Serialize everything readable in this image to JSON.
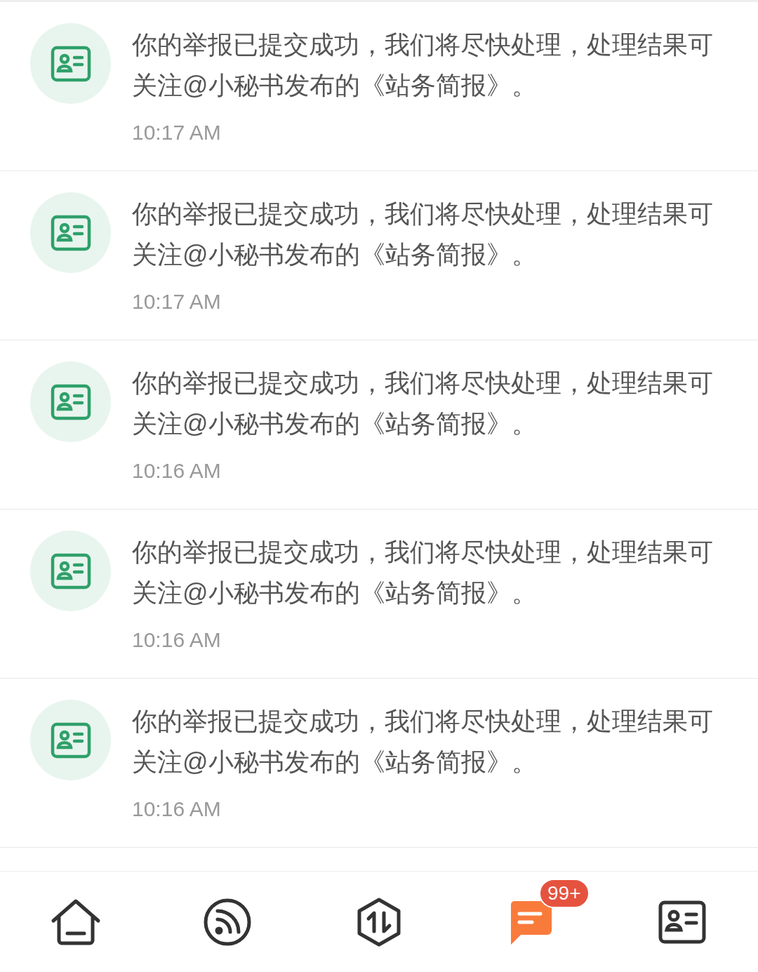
{
  "notifications": [
    {
      "message": "你的举报已提交成功，我们将尽快处理，处理结果可关注@小秘书发布的《站务简报》。",
      "time": "10:17 AM"
    },
    {
      "message": "你的举报已提交成功，我们将尽快处理，处理结果可关注@小秘书发布的《站务简报》。",
      "time": "10:17 AM"
    },
    {
      "message": "你的举报已提交成功，我们将尽快处理，处理结果可关注@小秘书发布的《站务简报》。",
      "time": "10:16 AM"
    },
    {
      "message": "你的举报已提交成功，我们将尽快处理，处理结果可关注@小秘书发布的《站务简报》。",
      "time": "10:16 AM"
    },
    {
      "message": "你的举报已提交成功，我们将尽快处理，处理结果可关注@小秘书发布的《站务简报》。",
      "time": "10:16 AM"
    }
  ],
  "bottom_nav": [
    {
      "selected": false
    },
    {
      "selected": false
    },
    {
      "selected": false
    },
    {
      "selected": true,
      "badge": "99+"
    },
    {
      "selected": false
    }
  ]
}
